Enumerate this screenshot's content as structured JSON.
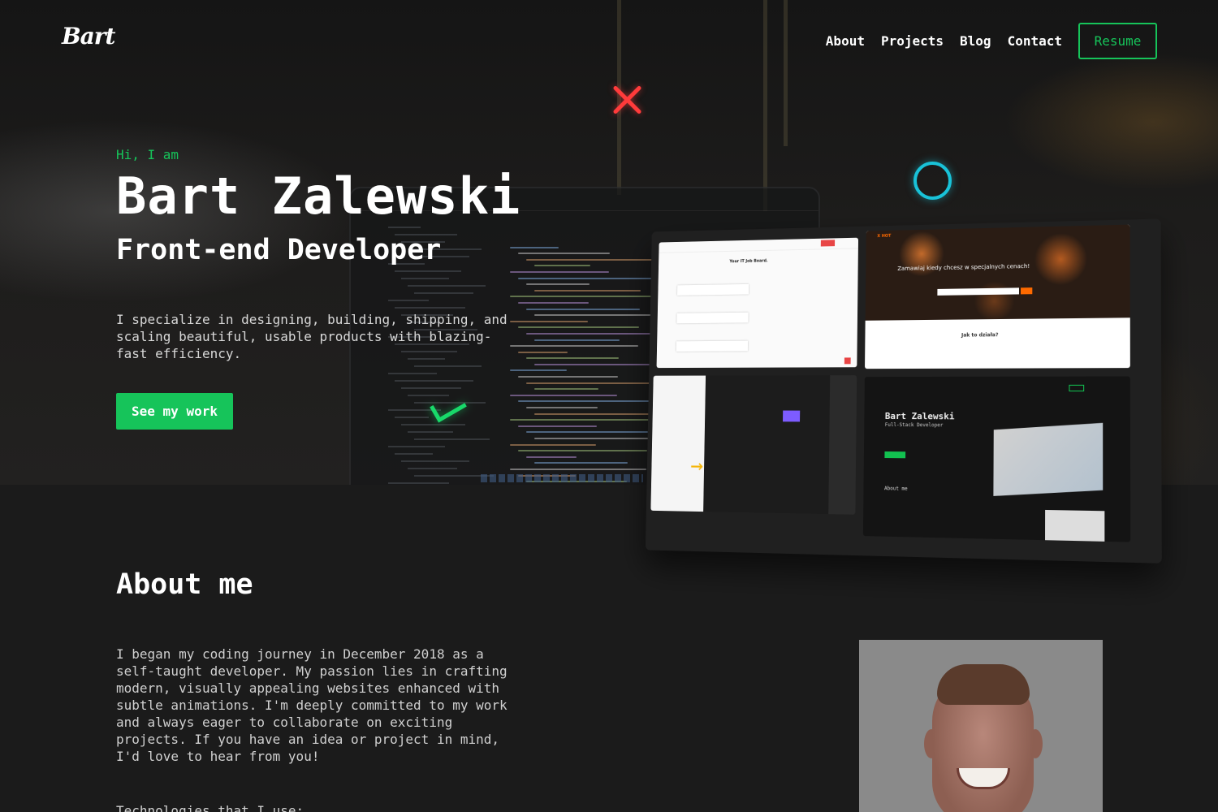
{
  "nav": {
    "logo": "Bart",
    "links": [
      "About",
      "Projects",
      "Blog",
      "Contact"
    ],
    "resume_label": "Resume"
  },
  "hero": {
    "greeting": "Hi, I am",
    "name": "Bart Zalewski",
    "role": "Front-end Developer",
    "intro": "I specialize in designing, building, shipping, and scaling beautiful, usable products with blazing-fast efficiency.",
    "cta_label": "See my work"
  },
  "hero_image": {
    "shot_a_title": "Your IT Job Board.",
    "shot_b_logo": "X HOT",
    "shot_b_headline": "Zamawiaj kiedy chcesz w specjalnych cenach!",
    "shot_b_how": "Jak to działa?",
    "shot_d_name": "Bart Zalewski",
    "shot_d_role": "Full-Stack Developer",
    "shot_d_about": "About me"
  },
  "about": {
    "heading": "About me",
    "paragraph": "I began my coding journey in December 2018 as a self-taught developer. My passion lies in crafting modern, visually appealing websites enhanced with subtle animations. I'm deeply committed to my work and always eager to collaborate on exciting projects. If you have an idea or project in mind, I'd love to hear from you!",
    "technologies_label": "Technologies that I use:"
  },
  "colors": {
    "accent": "#16c45a",
    "background": "#1b1b1b",
    "deco_x": "#ff3b3b",
    "deco_o": "#19c2d8"
  },
  "icons": [
    "close-x-decoration",
    "circle-decoration",
    "check-decoration"
  ]
}
